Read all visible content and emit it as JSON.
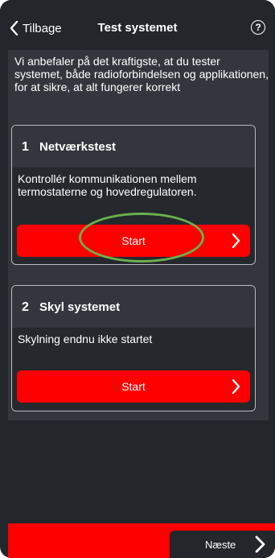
{
  "header": {
    "back_label": "Tilbage",
    "title": "Test systemet",
    "help_symbol": "?"
  },
  "intro": "Vi anbefaler på det kraftigste, at du tester systemet, både radioforbindelsen og applikationen, for at sikre, at alt fungerer korrekt",
  "cards": [
    {
      "number": "1",
      "title": "Netværkstest",
      "description": "Kontrollér kommunikationen mellem termostaterne og hovedregulatoren.",
      "button_label": "Start"
    },
    {
      "number": "2",
      "title": "Skyl systemet",
      "description": "Skylning endnu ikke startet",
      "button_label": "Start"
    }
  ],
  "footer": {
    "next_label": "Næste"
  },
  "colors": {
    "accent": "#ff0000",
    "background": "#23262b",
    "panel": "#33373d",
    "highlight": "#6ab04c"
  },
  "icons": [
    "chevron-left-icon",
    "help-icon",
    "chevron-right-icon"
  ]
}
